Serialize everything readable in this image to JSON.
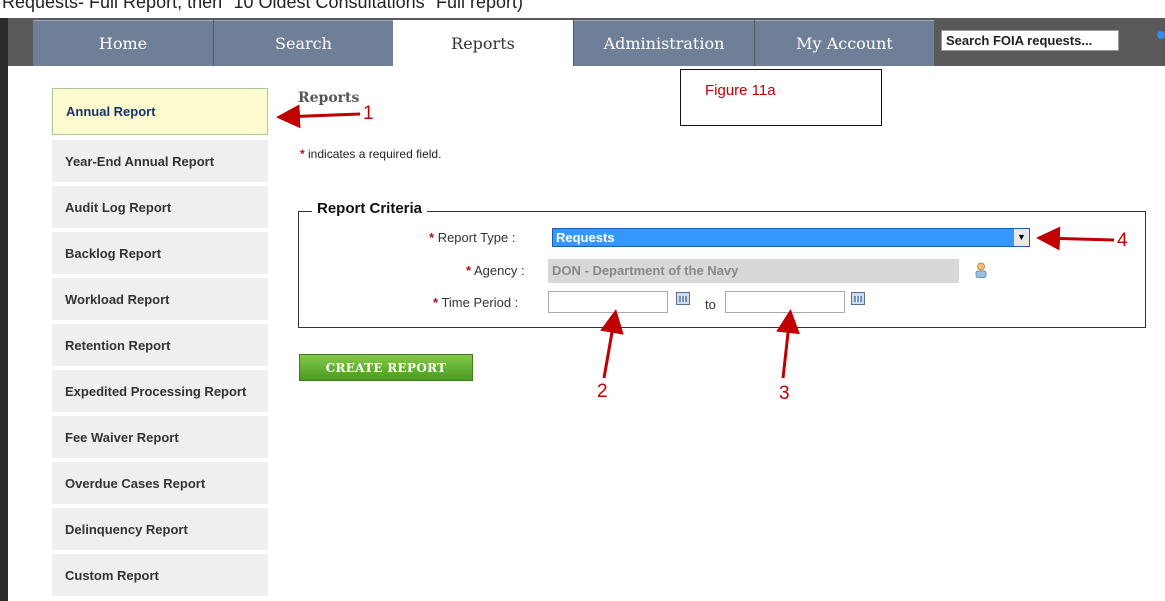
{
  "caption": "Requests- Full Report, then \"10 Oldest Consultations\" Full report)",
  "nav": {
    "tabs": [
      {
        "label": "Home"
      },
      {
        "label": "Search"
      },
      {
        "label": "Reports"
      },
      {
        "label": "Administration"
      },
      {
        "label": "My Account"
      }
    ],
    "active_tab": "Reports",
    "search_value": "Search FOIA requests..."
  },
  "sidebar": {
    "items": [
      {
        "label": "Annual Report"
      },
      {
        "label": "Year-End Annual Report"
      },
      {
        "label": "Audit Log Report"
      },
      {
        "label": "Backlog Report"
      },
      {
        "label": "Workload Report"
      },
      {
        "label": "Retention Report"
      },
      {
        "label": "Expedited Processing Report"
      },
      {
        "label": "Fee Waiver Report"
      },
      {
        "label": "Overdue Cases Report"
      },
      {
        "label": "Delinquency Report"
      },
      {
        "label": "Custom Report"
      }
    ],
    "active_item": "Annual Report"
  },
  "main": {
    "title": "Reports",
    "required_star": "*",
    "required_note": "indicates a required field.",
    "criteria": {
      "legend": "Report Criteria",
      "report_type_label": "Report Type :",
      "report_type_value": "Requests",
      "agency_label": "Agency :",
      "agency_value": "DON - Department of the Navy",
      "time_period_label": "Time Period :",
      "time_from_value": "",
      "time_to_value": "",
      "to_label": "to"
    },
    "create_button": "CREATE REPORT"
  },
  "annotations": {
    "figure_label": "Figure 11a",
    "numbers": [
      "1",
      "2",
      "3",
      "4"
    ]
  },
  "colors": {
    "accent": "#3399ff",
    "button_green": "#5aab2e",
    "annotation_red": "#c00000",
    "nav_tab": "#6f7f97"
  }
}
